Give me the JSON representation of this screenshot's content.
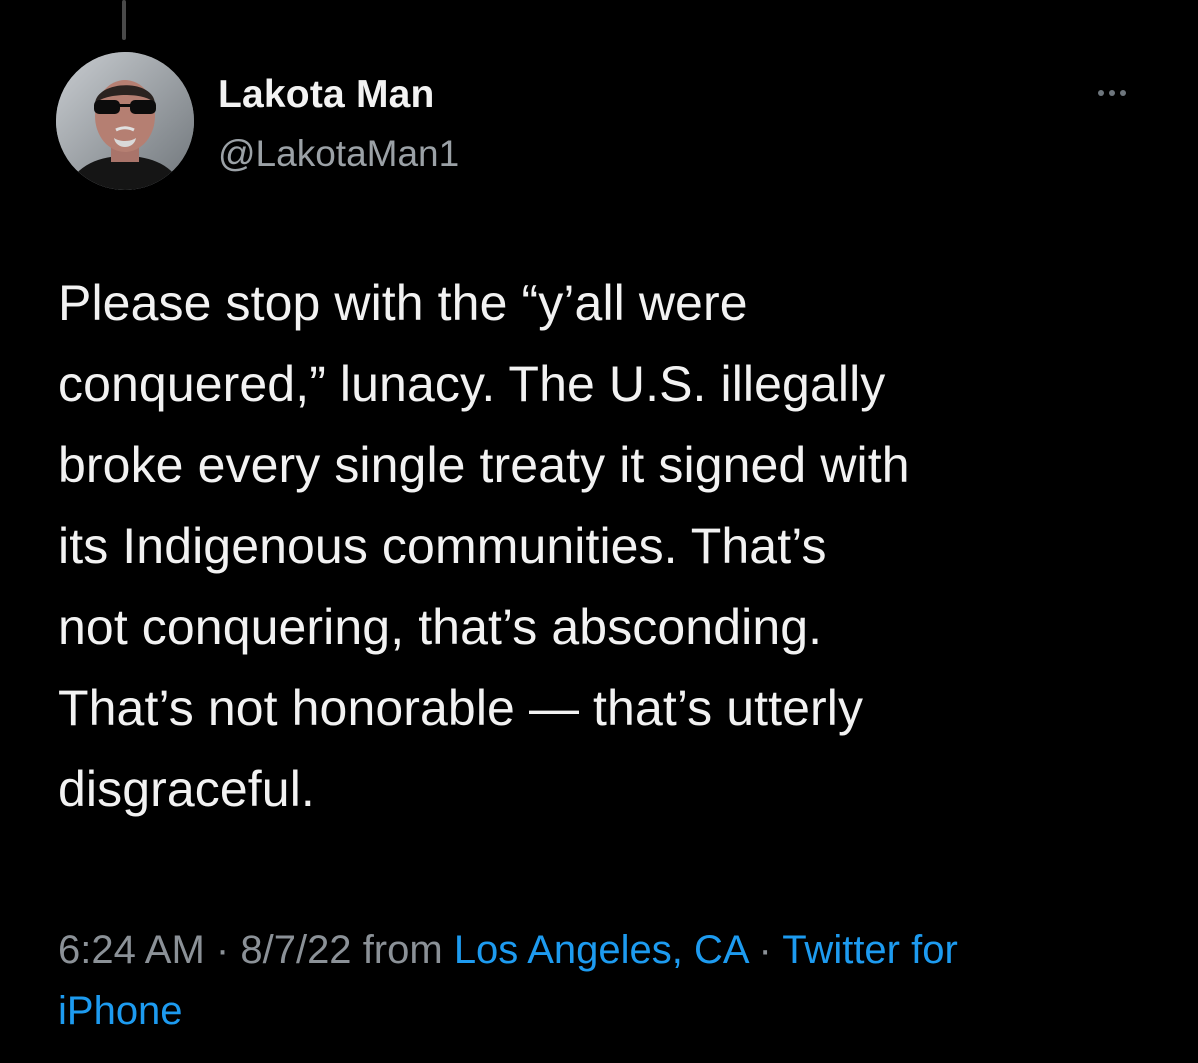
{
  "author": {
    "display_name": "Lakota Man",
    "handle": "@LakotaMan1",
    "avatar_icon": "profile-photo"
  },
  "more_icon": "ellipsis-icon",
  "tweet": {
    "text_lines": [
      "Please stop with the “y’all were",
      "conquered,” lunacy. The U.S. illegally",
      "broke every single treaty it signed with",
      "its Indigenous communities. That’s",
      "not conquering, that’s absconding.",
      "That’s not honorable — that’s utterly",
      "disgraceful."
    ]
  },
  "meta": {
    "time": "6:24 AM",
    "separator": "·",
    "date": "8/7/22",
    "from_word": "from",
    "location": "Los Angeles, CA",
    "source_line1": "Twitter for",
    "source_line2": "iPhone"
  },
  "colors": {
    "background": "#000000",
    "text": "#f2f2f2",
    "secondary": "#8b9197",
    "link": "#1d9bf0"
  }
}
